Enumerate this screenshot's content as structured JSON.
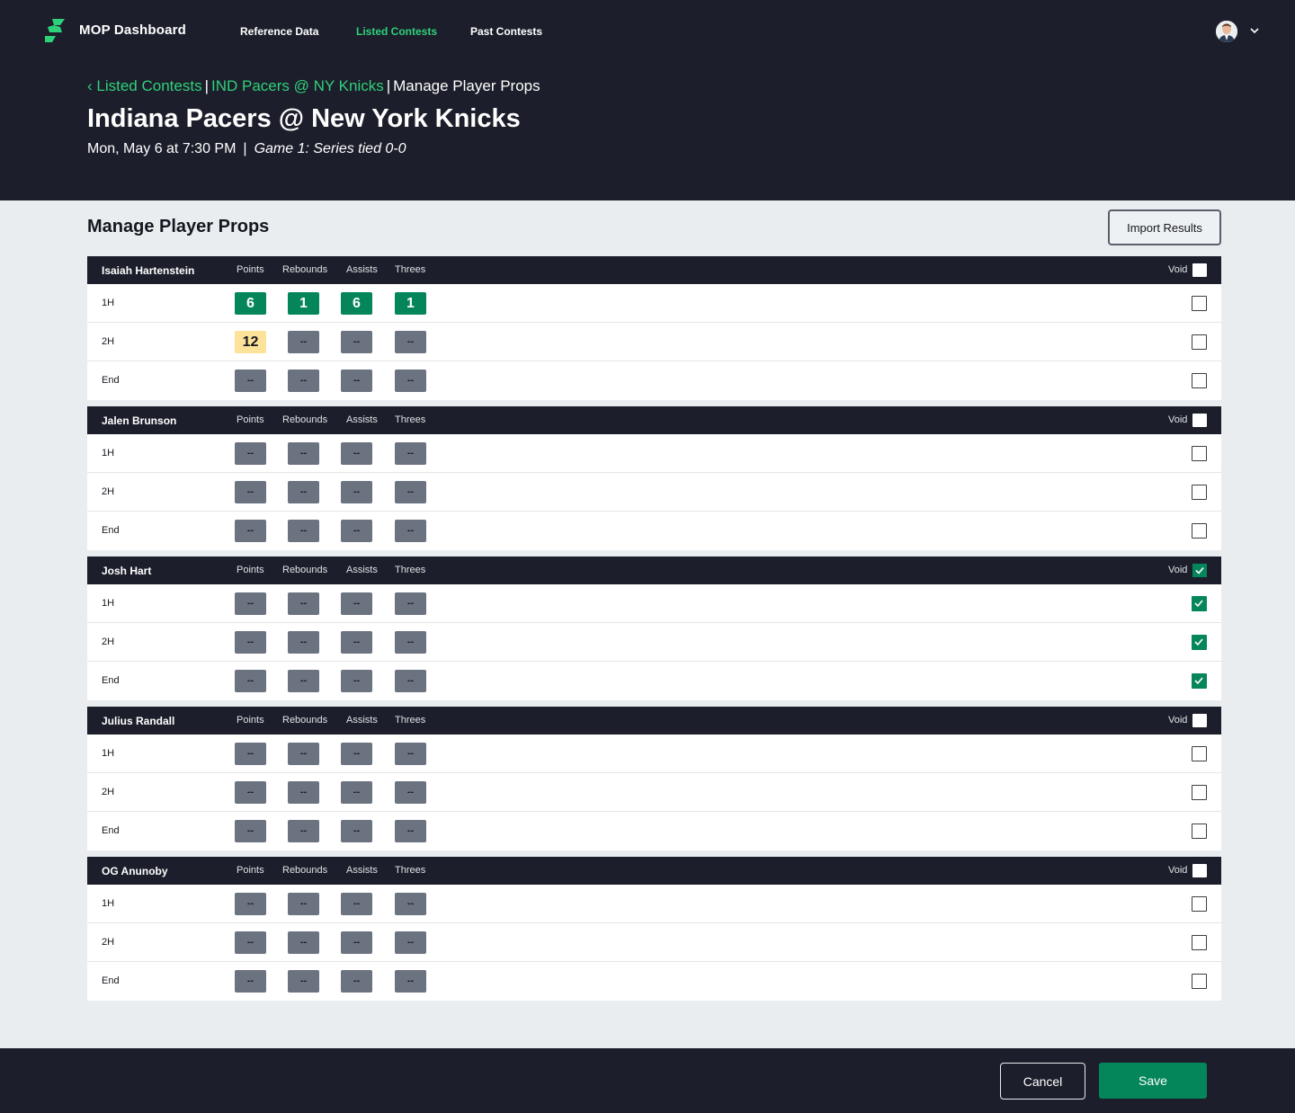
{
  "app": {
    "title": "MOP Dashboard"
  },
  "nav": {
    "links": [
      {
        "label": "Reference Data",
        "active": false
      },
      {
        "label": "Listed Contests",
        "active": true
      },
      {
        "label": "Past Contests",
        "active": false
      }
    ]
  },
  "breadcrumb": {
    "back_icon": "chevron-left-icon",
    "items": [
      "Listed Contests",
      "IND Pacers @ NY Knicks",
      "Manage Player Props"
    ],
    "separator": "|"
  },
  "contest": {
    "title": "Indiana Pacers @ New York Knicks",
    "datetime": "Mon, May 6 at 7:30 PM",
    "separator": "|",
    "series_note": "Game 1: Series tied 0-0"
  },
  "section": {
    "title": "Manage Player Props",
    "import_label": "Import Results"
  },
  "columns": [
    "Points",
    "Rebounds",
    "Assists",
    "Threes"
  ],
  "void_label": "Void",
  "players": [
    {
      "name": "Isaiah Hartenstein",
      "void": false,
      "rows": [
        {
          "label": "1H",
          "values": [
            "6",
            "1",
            "6",
            "1"
          ],
          "states": [
            "green",
            "green",
            "green",
            "green"
          ],
          "void": false
        },
        {
          "label": "2H",
          "values": [
            "12",
            "--",
            "--",
            "--"
          ],
          "states": [
            "yellow",
            "empty",
            "empty",
            "empty"
          ],
          "void": false
        },
        {
          "label": "End",
          "values": [
            "--",
            "--",
            "--",
            "--"
          ],
          "states": [
            "empty",
            "empty",
            "empty",
            "empty"
          ],
          "void": false
        }
      ]
    },
    {
      "name": "Jalen Brunson",
      "void": false,
      "rows": [
        {
          "label": "1H",
          "values": [
            "--",
            "--",
            "--",
            "--"
          ],
          "states": [
            "empty",
            "empty",
            "empty",
            "empty"
          ],
          "void": false
        },
        {
          "label": "2H",
          "values": [
            "--",
            "--",
            "--",
            "--"
          ],
          "states": [
            "empty",
            "empty",
            "empty",
            "empty"
          ],
          "void": false
        },
        {
          "label": "End",
          "values": [
            "--",
            "--",
            "--",
            "--"
          ],
          "states": [
            "empty",
            "empty",
            "empty",
            "empty"
          ],
          "void": false
        }
      ]
    },
    {
      "name": "Josh Hart",
      "void": true,
      "rows": [
        {
          "label": "1H",
          "values": [
            "--",
            "--",
            "--",
            "--"
          ],
          "states": [
            "empty",
            "empty",
            "empty",
            "empty"
          ],
          "void": true
        },
        {
          "label": "2H",
          "values": [
            "--",
            "--",
            "--",
            "--"
          ],
          "states": [
            "empty",
            "empty",
            "empty",
            "empty"
          ],
          "void": true
        },
        {
          "label": "End",
          "values": [
            "--",
            "--",
            "--",
            "--"
          ],
          "states": [
            "empty",
            "empty",
            "empty",
            "empty"
          ],
          "void": true
        }
      ]
    },
    {
      "name": "Julius Randall",
      "void": false,
      "rows": [
        {
          "label": "1H",
          "values": [
            "--",
            "--",
            "--",
            "--"
          ],
          "states": [
            "empty",
            "empty",
            "empty",
            "empty"
          ],
          "void": false
        },
        {
          "label": "2H",
          "values": [
            "--",
            "--",
            "--",
            "--"
          ],
          "states": [
            "empty",
            "empty",
            "empty",
            "empty"
          ],
          "void": false
        },
        {
          "label": "End",
          "values": [
            "--",
            "--",
            "--",
            "--"
          ],
          "states": [
            "empty",
            "empty",
            "empty",
            "empty"
          ],
          "void": false
        }
      ]
    },
    {
      "name": "OG Anunoby",
      "void": false,
      "rows": [
        {
          "label": "1H",
          "values": [
            "--",
            "--",
            "--",
            "--"
          ],
          "states": [
            "empty",
            "empty",
            "empty",
            "empty"
          ],
          "void": false
        },
        {
          "label": "2H",
          "values": [
            "--",
            "--",
            "--",
            "--"
          ],
          "states": [
            "empty",
            "empty",
            "empty",
            "empty"
          ],
          "void": false
        },
        {
          "label": "End",
          "values": [
            "--",
            "--",
            "--",
            "--"
          ],
          "states": [
            "empty",
            "empty",
            "empty",
            "empty"
          ],
          "void": false
        }
      ]
    }
  ],
  "footer": {
    "cancel_label": "Cancel",
    "save_label": "Save"
  },
  "colors": {
    "brand_green": "#2fd07a",
    "cell_green": "#05865a",
    "cell_yellow": "#fde29a",
    "cell_empty": "#6b7280",
    "header_dark": "#1c1f2b"
  }
}
